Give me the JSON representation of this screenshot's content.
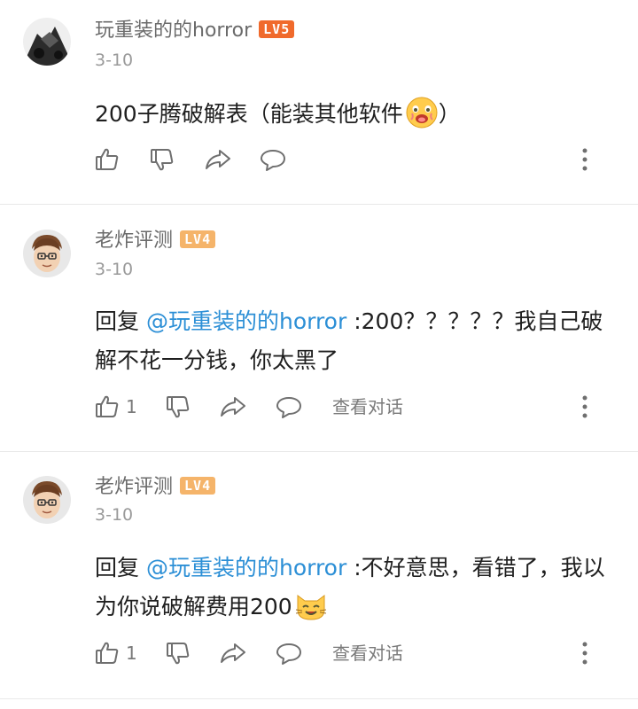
{
  "comments": [
    {
      "username": "玩重装的的horror",
      "level": "LV5",
      "level_color": "#f06a2c",
      "date": "3-10",
      "text": "200子腾破解表（能装其他软件",
      "text_after_emoji": "）",
      "emoji": "drooling-face-emoji",
      "like_count": "",
      "view_replies": ""
    },
    {
      "username": "老炸评测",
      "level": "LV4",
      "level_color": "#f5b46a",
      "date": "3-10",
      "reply_prefix": "回复",
      "mention": "@玩重装的的horror",
      "text": ":200？？？？？我自己破解不花一分钱，你太黑了",
      "like_count": "1",
      "view_replies": "查看对话"
    },
    {
      "username": "老炸评测",
      "level": "LV4",
      "level_color": "#f5b46a",
      "date": "3-10",
      "reply_prefix": "回复",
      "mention": "@玩重装的的horror",
      "text": ":不好意思，看错了，我以为你说破解费用200",
      "emoji": "cat-face-emoji",
      "like_count": "1",
      "view_replies": "查看对话"
    }
  ],
  "icons": {
    "like": "thumbs-up-icon",
    "dislike": "thumbs-down-icon",
    "share": "share-icon",
    "reply": "comment-bubble-icon",
    "more": "more-vertical-icon"
  }
}
